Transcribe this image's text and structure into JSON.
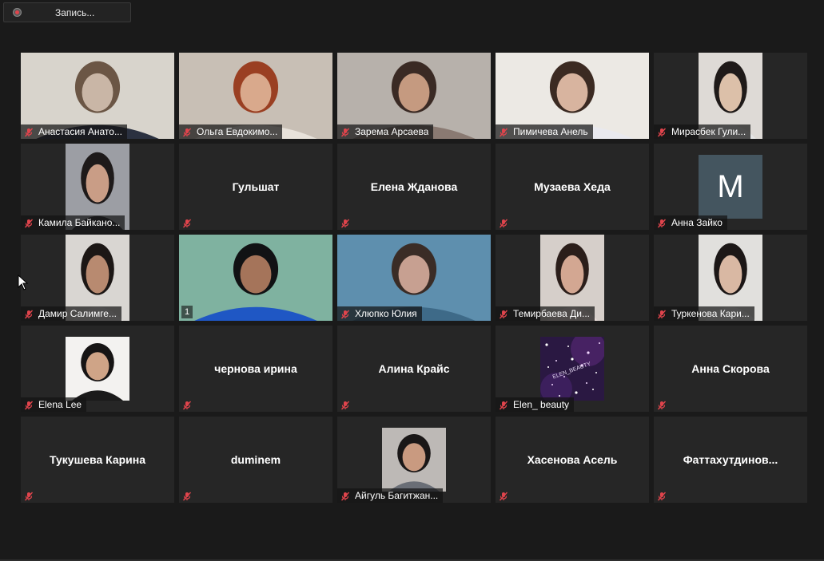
{
  "recording": {
    "label": "Запись..."
  },
  "tiles": [
    {
      "name": "Анастасия Анато...",
      "center": "",
      "kind": "photo-wide",
      "bg": "#2a2a2a",
      "skin": "#c9b6a6",
      "hair": "#6b5645",
      "shirt": "#2b3140",
      "wall": "#d8d4cc"
    },
    {
      "name": "Ольга Евдокимо...",
      "center": "",
      "kind": "photo-wide",
      "bg": "#c9c0b6",
      "skin": "#d9a98c",
      "hair": "#9a3f22",
      "shirt": "#e8e2da",
      "wall": "#c8bfb5"
    },
    {
      "name": "Зарема Арсаева",
      "center": "",
      "kind": "photo-wide",
      "bg": "#b9b3ad",
      "skin": "#c59a80",
      "hair": "#3a2a24",
      "shirt": "#8a7a72",
      "wall": "#b7b1ab"
    },
    {
      "name": "Пимичева Анель",
      "center": "",
      "kind": "photo-wide",
      "bg": "#e7e4df",
      "skin": "#d8b49f",
      "hair": "#3b2a22",
      "shirt": "#e9e9ee",
      "wall": "#ece9e4"
    },
    {
      "name": "Мирасбек Гули...",
      "center": "",
      "kind": "photo-narrow",
      "bg": "#d7d3cf",
      "skin": "#dcc0a9",
      "hair": "#1f1a19",
      "shirt": "#e6e6e6",
      "wall": "#dedad6"
    },
    {
      "name": "Камила Байкано...",
      "center": "",
      "kind": "photo-narrow",
      "bg": "#8a8a8e",
      "skin": "#c99d86",
      "hair": "#1e1a1a",
      "shirt": "#2a2830",
      "wall": "#9c9ea4"
    },
    {
      "name": "",
      "center": "Гульшат",
      "kind": "name"
    },
    {
      "name": "",
      "center": "Елена Жданова",
      "kind": "name"
    },
    {
      "name": "",
      "center": "Музаева Хеда",
      "kind": "name"
    },
    {
      "name": "Анна Зайко",
      "center": "",
      "kind": "letter",
      "letter": "M"
    },
    {
      "name": "Дамир Салимге...",
      "center": "",
      "kind": "photo-narrow",
      "bg": "#dad7d3",
      "skin": "#b88a70",
      "hair": "#1c1715",
      "shirt": "#e5e3e0",
      "wall": "#d9d6d2"
    },
    {
      "name": "",
      "center": "",
      "kind": "active",
      "number": "1",
      "bg": "#6fa08e",
      "skin": "#a5745a",
      "hair": "#111214",
      "shirt": "#1f57c4",
      "wall": "#7fb2a0"
    },
    {
      "name": "Хлюпко Юлия",
      "center": "",
      "kind": "photo-wide",
      "bg": "#5c8aa8",
      "skin": "#c7a091",
      "hair": "#3a2c26",
      "shirt": "#3e6a88",
      "wall": "#5e8fae"
    },
    {
      "name": "Темирбаева Ди...",
      "center": "",
      "kind": "photo-narrow",
      "bg": "#d2cbc6",
      "skin": "#d3a792",
      "hair": "#2b1e1a",
      "shirt": "#e8dcd8",
      "wall": "#d6cfca"
    },
    {
      "name": "Туркенова Кари...",
      "center": "",
      "kind": "photo-narrow",
      "bg": "#dcdbd8",
      "skin": "#d9b8a3",
      "hair": "#1c1716",
      "shirt": "#f0f0f0",
      "wall": "#e1e0dd"
    },
    {
      "name": "Elena Lee",
      "center": "",
      "kind": "photo-small",
      "bg": "#f1f0ee",
      "skin": "#cfa487",
      "hair": "#161414",
      "shirt": "#1a1a1a",
      "wall": "#f3f2f0"
    },
    {
      "name": "",
      "center": "чернова ирина",
      "kind": "name"
    },
    {
      "name": "",
      "center": "Алина Крайс",
      "kind": "name"
    },
    {
      "name": "Elen_ beauty",
      "center": "",
      "kind": "sparkle",
      "sparkle_text": "ELEN_BEAUTY"
    },
    {
      "name": "",
      "center": "Анна Скорова",
      "kind": "name"
    },
    {
      "name": "",
      "center": "Тукушева Карина",
      "kind": "name"
    },
    {
      "name": "",
      "center": "duminem",
      "kind": "name"
    },
    {
      "name": "Айгуль Багитжан...",
      "center": "",
      "kind": "photo-small",
      "bg": "#b9b6b4",
      "skin": "#c99a80",
      "hair": "#1a1717",
      "shirt": "#6a6e76",
      "wall": "#bdb9b6"
    },
    {
      "name": "",
      "center": "Хасенова Асель",
      "kind": "name"
    },
    {
      "name": "",
      "center": "Фаттахутдинов...",
      "kind": "name"
    }
  ],
  "colors": {
    "background": "#1a1a1a",
    "tile": "#262626",
    "active_border": "#d6e24a",
    "mute": "#e0444c"
  }
}
